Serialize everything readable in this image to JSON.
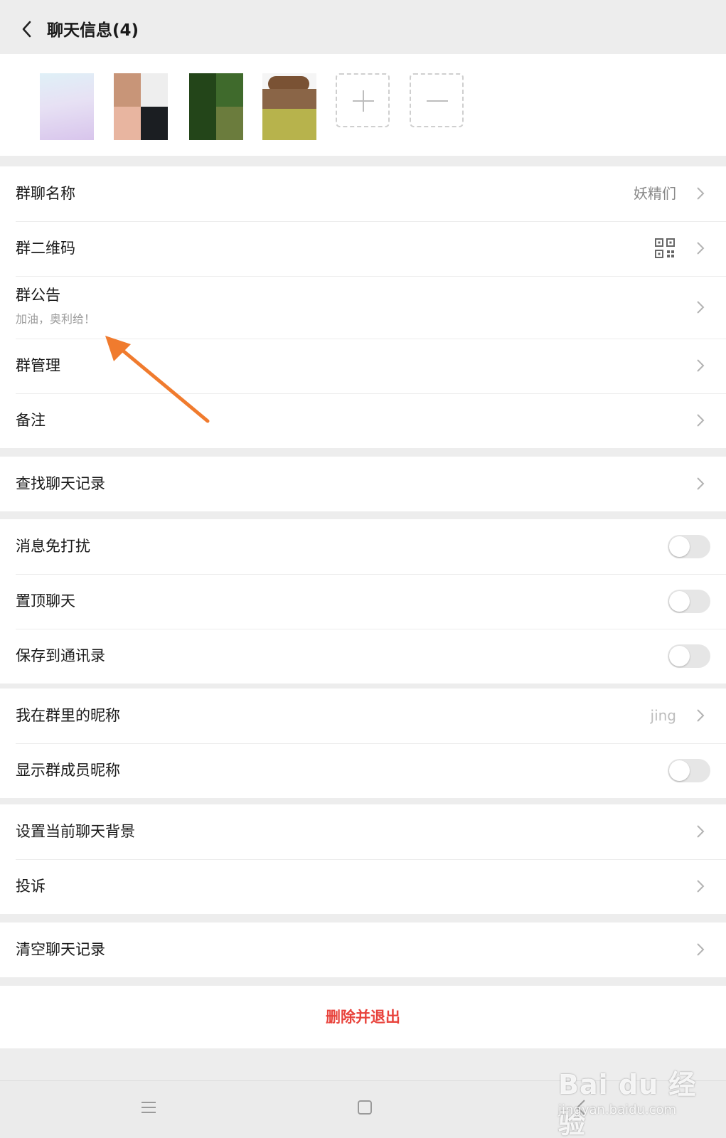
{
  "header": {
    "title": "聊天信息(4)"
  },
  "members": {
    "count": 4,
    "add_icon": "plus-icon",
    "remove_icon": "minus-icon"
  },
  "group_info": [
    {
      "label": "群聊名称",
      "value": "妖精们",
      "control": "chevron"
    },
    {
      "label": "群二维码",
      "icon": "qr-code-icon",
      "control": "chevron"
    },
    {
      "label": "群公告",
      "subtitle": "加油，奥利给！",
      "control": "chevron"
    },
    {
      "label": "群管理",
      "control": "chevron"
    },
    {
      "label": "备注",
      "control": "chevron"
    }
  ],
  "search": [
    {
      "label": "查找聊天记录",
      "control": "chevron"
    }
  ],
  "toggles": [
    {
      "label": "消息免打扰",
      "on": false
    },
    {
      "label": "置顶聊天",
      "on": false
    },
    {
      "label": "保存到通讯录",
      "on": false
    }
  ],
  "nickname": [
    {
      "label": "我在群里的昵称",
      "value": "jing",
      "control": "chevron"
    },
    {
      "label": "显示群成员昵称",
      "on": false
    }
  ],
  "misc": [
    {
      "label": "设置当前聊天背景",
      "control": "chevron"
    },
    {
      "label": "投诉",
      "control": "chevron"
    }
  ],
  "clear": [
    {
      "label": "清空聊天记录",
      "control": "chevron"
    }
  ],
  "danger": {
    "label": "删除并退出"
  },
  "colors": {
    "background": "#ededed",
    "danger": "#e8433c",
    "annotation_arrow": "#f07b2e"
  },
  "watermark": {
    "text": "Bai du 经验",
    "url": "jingyan.baidu.com"
  },
  "bottom_nav": {
    "icons": [
      "menu-icon",
      "home-icon",
      "back-icon"
    ]
  }
}
